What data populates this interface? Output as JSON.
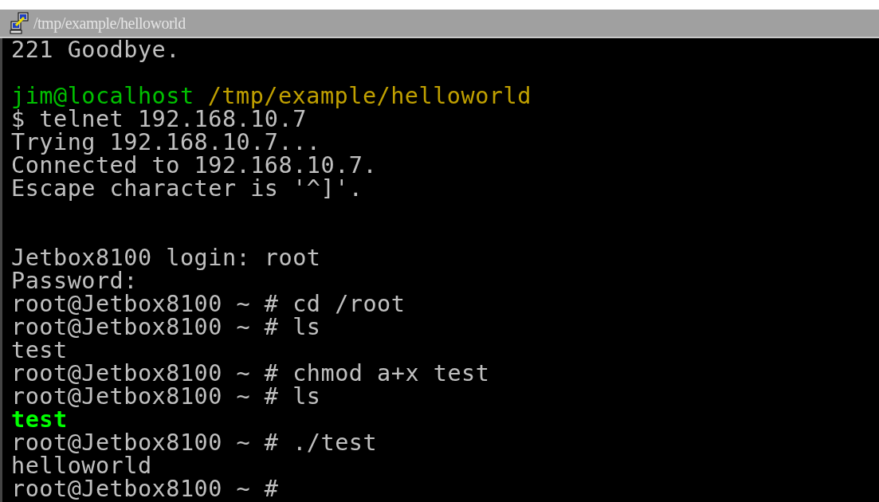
{
  "window": {
    "title": "/tmp/example/helloworld"
  },
  "terminal": {
    "lines": [
      {
        "kind": "text",
        "segments": [
          {
            "kind": "plain",
            "text": "221 Goodbye."
          }
        ]
      },
      {
        "kind": "blank"
      },
      {
        "kind": "text",
        "segments": [
          {
            "kind": "user",
            "text": "jim@localhost"
          },
          {
            "kind": "path",
            "text": "/tmp/example/helloworld"
          }
        ]
      },
      {
        "kind": "text",
        "segments": [
          {
            "kind": "plain",
            "text": "$ telnet 192.168.10.7"
          }
        ]
      },
      {
        "kind": "text",
        "segments": [
          {
            "kind": "plain",
            "text": "Trying 192.168.10.7..."
          }
        ]
      },
      {
        "kind": "text",
        "segments": [
          {
            "kind": "plain",
            "text": "Connected to 192.168.10.7."
          }
        ]
      },
      {
        "kind": "text",
        "segments": [
          {
            "kind": "plain",
            "text": "Escape character is '^]'."
          }
        ]
      },
      {
        "kind": "blank"
      },
      {
        "kind": "blank"
      },
      {
        "kind": "text",
        "segments": [
          {
            "kind": "plain",
            "text": "Jetbox8100 login: root"
          }
        ]
      },
      {
        "kind": "text",
        "segments": [
          {
            "kind": "plain",
            "text": "Password:"
          }
        ]
      },
      {
        "kind": "text",
        "segments": [
          {
            "kind": "plain",
            "text": "root@Jetbox8100 ~ # cd /root"
          }
        ]
      },
      {
        "kind": "text",
        "segments": [
          {
            "kind": "plain",
            "text": "root@Jetbox8100 ~ # ls"
          }
        ]
      },
      {
        "kind": "text",
        "segments": [
          {
            "kind": "plain",
            "text": "test"
          }
        ]
      },
      {
        "kind": "text",
        "segments": [
          {
            "kind": "plain",
            "text": "root@Jetbox8100 ~ # chmod a+x test"
          }
        ]
      },
      {
        "kind": "text",
        "segments": [
          {
            "kind": "plain",
            "text": "root@Jetbox8100 ~ # ls"
          }
        ]
      },
      {
        "kind": "text",
        "segments": [
          {
            "kind": "executable",
            "text": "test"
          }
        ]
      },
      {
        "kind": "text",
        "segments": [
          {
            "kind": "plain",
            "text": "root@Jetbox8100 ~ # ./test"
          }
        ]
      },
      {
        "kind": "text",
        "segments": [
          {
            "kind": "plain",
            "text": "helloworld"
          }
        ]
      },
      {
        "kind": "text",
        "segments": [
          {
            "kind": "plain",
            "text": "root@Jetbox8100 ~ #"
          }
        ]
      }
    ]
  }
}
